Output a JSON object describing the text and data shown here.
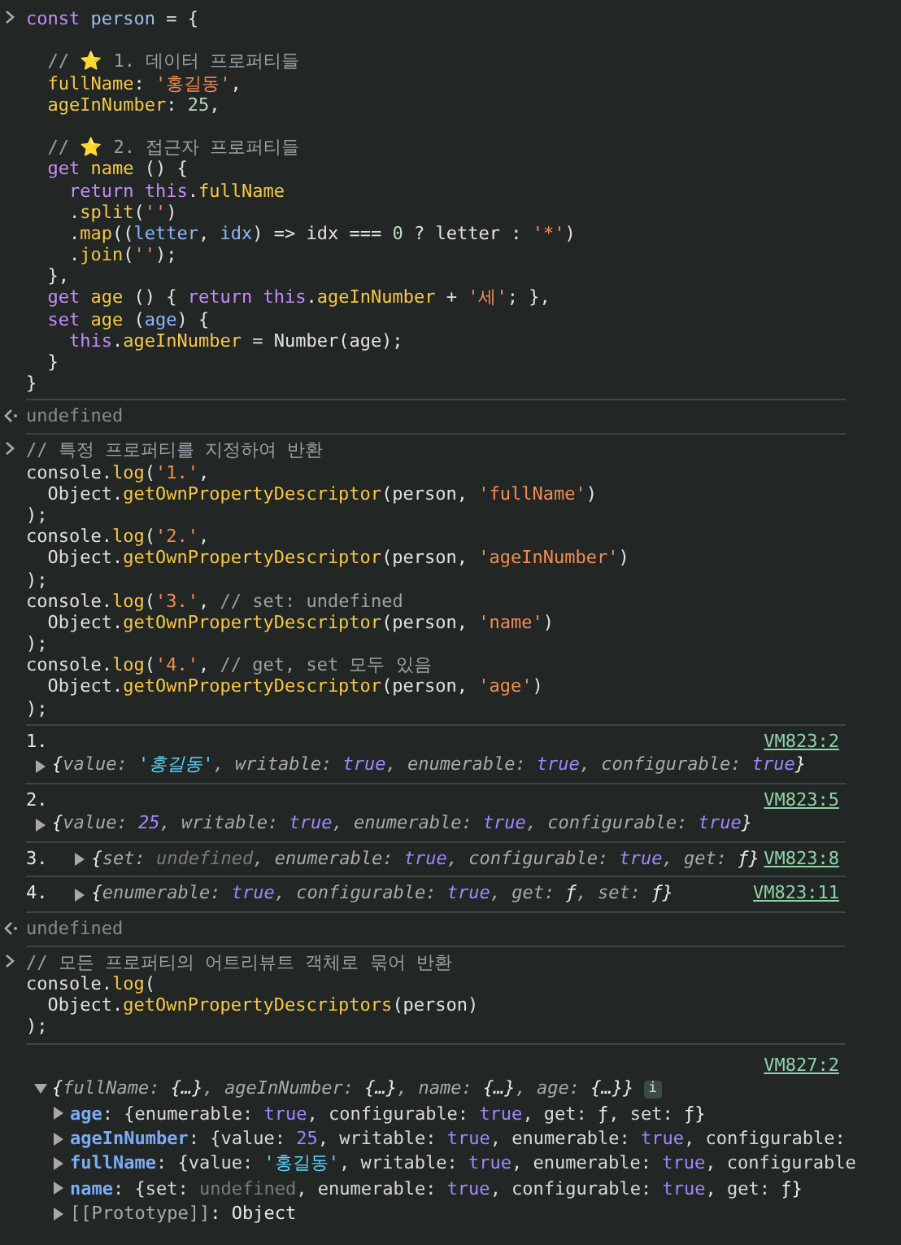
{
  "entries": [
    {
      "kind": "input",
      "lines": [
        {
          "tokens": [
            {
              "kw": "const"
            },
            {
              "def": " person "
            },
            {
              "pn": "= {"
            }
          ]
        },
        {
          "spaced": true,
          "tokens": [
            {
              "cm": "  // "
            },
            {
              "star": "⭐"
            },
            {
              "cm": " 1. 데이터 프로퍼티들"
            }
          ]
        },
        {
          "tokens": [
            {
              "prop": "  fullName"
            },
            {
              "pn": ": "
            },
            {
              "str": "'홍길동'"
            },
            {
              "pn": ","
            }
          ]
        },
        {
          "tokens": [
            {
              "prop": "  ageInNumber"
            },
            {
              "pn": ": "
            },
            {
              "num": "25"
            },
            {
              "pn": ","
            }
          ]
        },
        {
          "spaced": true,
          "tokens": [
            {
              "cm": "  // "
            },
            {
              "star": "⭐"
            },
            {
              "cm": " 2. 접근자 프로퍼티들"
            }
          ]
        },
        {
          "tokens": [
            {
              "kw": "  get"
            },
            {
              "prop": " name"
            },
            {
              "pn": " () {"
            }
          ]
        },
        {
          "tokens": [
            {
              "kw": "    return this"
            },
            {
              "pn": "."
            },
            {
              "prop": "fullName"
            }
          ]
        },
        {
          "tokens": [
            {
              "pn": "    ."
            },
            {
              "prop": "split"
            },
            {
              "pn": "("
            },
            {
              "str": "''"
            },
            {
              "pn": ")"
            }
          ]
        },
        {
          "tokens": [
            {
              "pn": "    ."
            },
            {
              "prop": "map"
            },
            {
              "pn": "(("
            },
            {
              "param": "letter"
            },
            {
              "pn": ", "
            },
            {
              "param": "idx"
            },
            {
              "pn": ") => idx === "
            },
            {
              "num": "0"
            },
            {
              "pn": " ? letter : "
            },
            {
              "str": "'*'"
            },
            {
              "pn": ")"
            }
          ]
        },
        {
          "tokens": [
            {
              "pn": "    ."
            },
            {
              "prop": "join"
            },
            {
              "pn": "("
            },
            {
              "str": "''"
            },
            {
              "pn": ");"
            }
          ]
        },
        {
          "tokens": [
            {
              "pn": "  },"
            }
          ]
        },
        {
          "tokens": [
            {
              "kw": "  get"
            },
            {
              "prop": " age"
            },
            {
              "pn": " () { "
            },
            {
              "kw": "return this"
            },
            {
              "pn": "."
            },
            {
              "prop": "ageInNumber"
            },
            {
              "pn": " + "
            },
            {
              "str": "'세'"
            },
            {
              "pn": "; },"
            }
          ]
        },
        {
          "tokens": [
            {
              "kw": "  set"
            },
            {
              "prop": " age"
            },
            {
              "pn": " ("
            },
            {
              "param": "age"
            },
            {
              "pn": ") {"
            }
          ]
        },
        {
          "tokens": [
            {
              "kw": "    this"
            },
            {
              "pn": "."
            },
            {
              "prop": "ageInNumber"
            },
            {
              "pn": " = Number(age);"
            }
          ]
        },
        {
          "tokens": [
            {
              "pn": "  }"
            }
          ]
        },
        {
          "tokens": [
            {
              "pn": "}"
            }
          ]
        }
      ]
    },
    {
      "kind": "return",
      "text": "undefined"
    },
    {
      "kind": "input",
      "lines": [
        {
          "tokens": [
            {
              "cm": "// 특정 프로퍼티를 지정하여 반환"
            }
          ]
        },
        {
          "tokens": [
            {
              "pn": "console."
            },
            {
              "prop": "log"
            },
            {
              "pn": "("
            },
            {
              "str": "'1.'"
            },
            {
              "pn": ","
            }
          ]
        },
        {
          "tokens": [
            {
              "pn": "  Object."
            },
            {
              "prop": "getOwnPropertyDescriptor"
            },
            {
              "pn": "(person, "
            },
            {
              "str": "'fullName'"
            },
            {
              "pn": ")"
            }
          ]
        },
        {
          "tokens": [
            {
              "pn": ");"
            }
          ]
        },
        {
          "tokens": [
            {
              "pn": "console."
            },
            {
              "prop": "log"
            },
            {
              "pn": "("
            },
            {
              "str": "'2.'"
            },
            {
              "pn": ","
            }
          ]
        },
        {
          "tokens": [
            {
              "pn": "  Object."
            },
            {
              "prop": "getOwnPropertyDescriptor"
            },
            {
              "pn": "(person, "
            },
            {
              "str": "'ageInNumber'"
            },
            {
              "pn": ")"
            }
          ]
        },
        {
          "tokens": [
            {
              "pn": ");"
            }
          ]
        },
        {
          "tokens": [
            {
              "pn": "console."
            },
            {
              "prop": "log"
            },
            {
              "pn": "("
            },
            {
              "str": "'3.'"
            },
            {
              "pn": ", "
            },
            {
              "cm": "// set: undefined"
            }
          ]
        },
        {
          "tokens": [
            {
              "pn": "  Object."
            },
            {
              "prop": "getOwnPropertyDescriptor"
            },
            {
              "pn": "(person, "
            },
            {
              "str": "'name'"
            },
            {
              "pn": ")"
            }
          ]
        },
        {
          "tokens": [
            {
              "pn": ");"
            }
          ]
        },
        {
          "tokens": [
            {
              "pn": "console."
            },
            {
              "prop": "log"
            },
            {
              "pn": "("
            },
            {
              "str": "'4.'"
            },
            {
              "pn": ", "
            },
            {
              "cm": "// get, set 모두 있음"
            }
          ]
        },
        {
          "tokens": [
            {
              "pn": "  Object."
            },
            {
              "prop": "getOwnPropertyDescriptor"
            },
            {
              "pn": "(person, "
            },
            {
              "str": "'age'"
            },
            {
              "pn": ")"
            }
          ]
        },
        {
          "tokens": [
            {
              "pn": ");"
            }
          ]
        }
      ]
    },
    {
      "kind": "log",
      "label": "1.",
      "source": "VM823:2",
      "inline": false,
      "expanded": false,
      "value": [
        {
          "brace": "{"
        },
        {
          "key": "value: "
        },
        {
          "ostr": "'홍길동'"
        },
        {
          "key": ", writable: "
        },
        {
          "bool": "true"
        },
        {
          "key": ", enumerable: "
        },
        {
          "bool": "true"
        },
        {
          "key": ", configurable: "
        },
        {
          "bool": "true"
        },
        {
          "brace": "}"
        }
      ]
    },
    {
      "kind": "log",
      "label": "2.",
      "source": "VM823:5",
      "inline": false,
      "expanded": false,
      "value": [
        {
          "brace": "{"
        },
        {
          "key": "value: "
        },
        {
          "onum": "25"
        },
        {
          "key": ", writable: "
        },
        {
          "bool": "true"
        },
        {
          "key": ", enumerable: "
        },
        {
          "bool": "true"
        },
        {
          "key": ", configurable: "
        },
        {
          "bool": "true"
        },
        {
          "brace": "}"
        }
      ]
    },
    {
      "kind": "log",
      "label": "3.",
      "source": "VM823:8",
      "inline": true,
      "expanded": false,
      "value": [
        {
          "brace": "{"
        },
        {
          "key": "set: "
        },
        {
          "undef": "undefined"
        },
        {
          "key": ", enumerable: "
        },
        {
          "bool": "true"
        },
        {
          "key": ", configurable: "
        },
        {
          "bool": "true"
        },
        {
          "key": ", get: "
        },
        {
          "fn": "ƒ"
        },
        {
          "brace": "}"
        }
      ]
    },
    {
      "kind": "log",
      "label": "4.",
      "source": "VM823:11",
      "inline": true,
      "expanded": false,
      "value": [
        {
          "brace": "{"
        },
        {
          "key": "enumerable: "
        },
        {
          "bool": "true"
        },
        {
          "key": ", configurable: "
        },
        {
          "bool": "true"
        },
        {
          "key": ", get: "
        },
        {
          "fn": "ƒ"
        },
        {
          "key": ", set: "
        },
        {
          "fn": "ƒ"
        },
        {
          "brace": "}"
        }
      ]
    },
    {
      "kind": "return",
      "text": "undefined"
    },
    {
      "kind": "input",
      "lines": [
        {
          "tokens": [
            {
              "cm": "// 모든 프로퍼티의 어트리뷰트 객체로 묶어 반환"
            }
          ]
        },
        {
          "tokens": [
            {
              "pn": "console."
            },
            {
              "prop": "log"
            },
            {
              "pn": "("
            }
          ]
        },
        {
          "tokens": [
            {
              "pn": "  Object."
            },
            {
              "prop": "getOwnPropertyDescriptors"
            },
            {
              "pn": "(person)"
            }
          ]
        },
        {
          "tokens": [
            {
              "pn": ");"
            }
          ]
        }
      ]
    },
    {
      "kind": "tree",
      "source": "VM827:2",
      "expanded": true,
      "summary": [
        {
          "brace": "{"
        },
        {
          "key": "fullName: "
        },
        {
          "brace": "{…}"
        },
        {
          "key": ", ageInNumber: "
        },
        {
          "brace": "{…}"
        },
        {
          "key": ", name: "
        },
        {
          "brace": "{…}"
        },
        {
          "key": ", age: "
        },
        {
          "brace": "{…}"
        },
        {
          "brace": "}"
        }
      ],
      "info": "i",
      "children": [
        {
          "expanded": false,
          "tokens": [
            {
              "tkey": "age"
            },
            {
              "tpn": ": {enumerable: "
            },
            {
              "tbool": "true"
            },
            {
              "tpn": ", configurable: "
            },
            {
              "tbool": "true"
            },
            {
              "tpn": ", get: "
            },
            {
              "fn": "ƒ"
            },
            {
              "tpn": ", set: "
            },
            {
              "fn": "ƒ"
            },
            {
              "brace": "}"
            }
          ]
        },
        {
          "expanded": false,
          "tokens": [
            {
              "tkey": "ageInNumber"
            },
            {
              "tpn": ": {value: "
            },
            {
              "tbool": "25"
            },
            {
              "tpn": ", writable: "
            },
            {
              "tbool": "true"
            },
            {
              "tpn": ", enumerable: "
            },
            {
              "tbool": "true"
            },
            {
              "tpn": ", configurable:"
            }
          ]
        },
        {
          "expanded": false,
          "tokens": [
            {
              "tkey": "fullName"
            },
            {
              "tpn": ": {value: "
            },
            {
              "tstr": "'홍길동'"
            },
            {
              "tpn": ", writable: "
            },
            {
              "tbool": "true"
            },
            {
              "tpn": ", enumerable: "
            },
            {
              "tbool": "true"
            },
            {
              "tpn": ", configurable"
            }
          ]
        },
        {
          "expanded": false,
          "tokens": [
            {
              "tkey": "name"
            },
            {
              "tpn": ": {set: "
            },
            {
              "undef": "undefined"
            },
            {
              "tpn": ", enumerable: "
            },
            {
              "tbool": "true"
            },
            {
              "tpn": ", configurable: "
            },
            {
              "tbool": "true"
            },
            {
              "tpn": ", get: "
            },
            {
              "fn": "ƒ"
            },
            {
              "brace": "}"
            }
          ]
        },
        {
          "expanded": false,
          "tokens": [
            {
              "proto": "[[Prototype]]"
            },
            {
              "brace": ": Object"
            }
          ]
        }
      ]
    }
  ]
}
